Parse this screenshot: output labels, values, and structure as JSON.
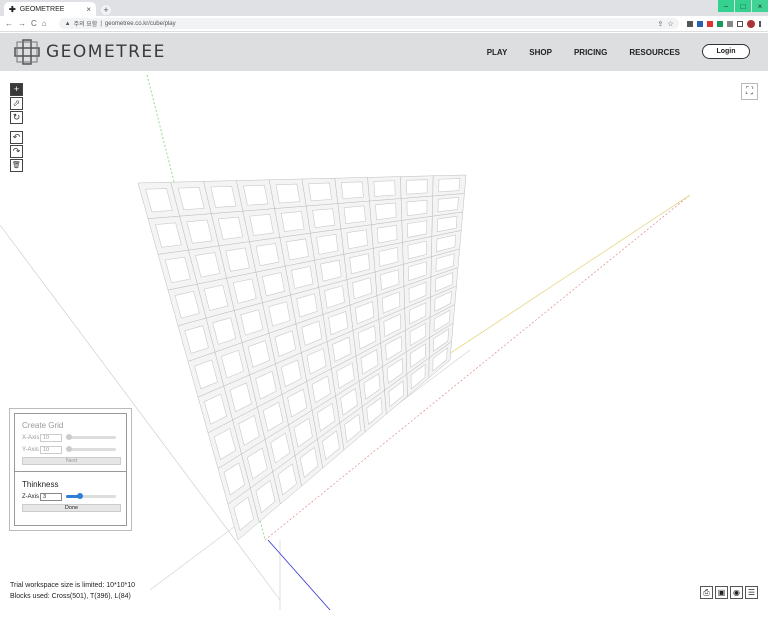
{
  "browser": {
    "tab_title": "GEOMETREE",
    "tab_close": "×",
    "new_tab": "+",
    "url_prefix": "주의 요함",
    "url": "geometree.co.kr/cube/play",
    "nav_back": "←",
    "nav_forward": "→",
    "nav_reload": "C",
    "nav_home": "⌂",
    "win_min": "−",
    "win_max": "□",
    "win_close": "×"
  },
  "header": {
    "logo_text": "GEOMETREE",
    "menu": [
      "PLAY",
      "SHOP",
      "PRICING",
      "RESOURCES"
    ],
    "login": "Login"
  },
  "toolbar": {
    "add": "+",
    "select": "⬀",
    "rotate": "↻",
    "undo": "↶",
    "redo": "↷",
    "delete": "🗑"
  },
  "panel": {
    "create_grid_title": "Create Grid",
    "x_axis_label": "X-Axis",
    "x_axis_value": "10",
    "y_axis_label": "Y-Axis",
    "y_axis_value": "10",
    "next_label": "Next",
    "thickness_title": "Thinkness",
    "z_axis_label": "Z-Axis",
    "z_axis_value": "3",
    "done_label": "Done"
  },
  "status": {
    "line1": "Trial workspace size is limited: 10*10*10",
    "line2": "Blocks used: Cross(501), T(396), L(84)"
  },
  "colors": {
    "header_bg": "#dcdee0",
    "accent": "#2f7fd6",
    "axis_green": "#7ad07a",
    "axis_red": "#e08a8a",
    "axis_blue": "#3b3bd6",
    "axis_yellow": "#e6d88a"
  }
}
